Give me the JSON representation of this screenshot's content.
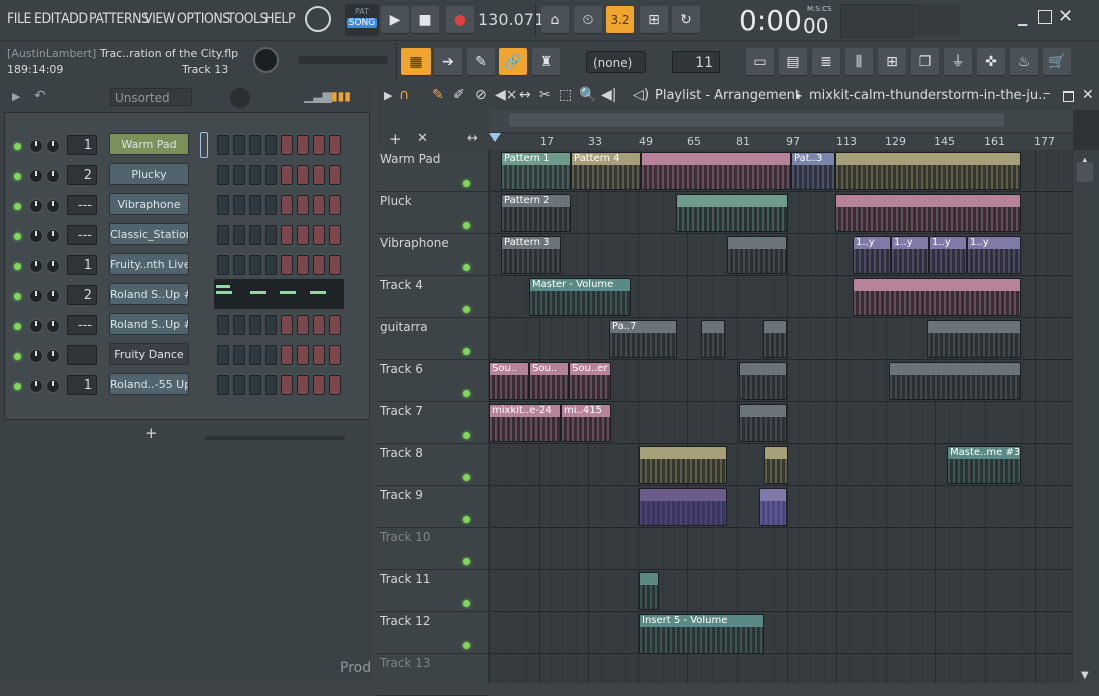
{
  "menu": [
    "FILE",
    "EDIT",
    "ADD",
    "PATTERNS",
    "VIEW",
    "OPTIONS",
    "TOOLS",
    "HELP"
  ],
  "transport": {
    "pat_label": "PAT",
    "song_label": "SONG",
    "tempo": "130.071",
    "time_main": "0:00",
    "time_sub": "00",
    "time_unit": "M:S:CS",
    "pattern_num": "3.2"
  },
  "project": {
    "title": "[AustinLambert]",
    "file": "Trac..ration of the City.flp",
    "position": "189:14:09",
    "track_hint": "Track 13"
  },
  "toolbar2": {
    "pattern_selector": "(none)",
    "step_value": "11"
  },
  "rack": {
    "filter": "Unsorted",
    "add": "+",
    "channels": [
      {
        "num": "1",
        "name": "Warm Pad"
      },
      {
        "num": "2",
        "name": "Plucky"
      },
      {
        "num": "---",
        "name": "Vibraphone"
      },
      {
        "num": "---",
        "name": "Classic_Station"
      },
      {
        "num": "1",
        "name": "Fruity..nth Live"
      },
      {
        "num": "2",
        "name": "Roland S..Up #2"
      },
      {
        "num": "---",
        "name": "Roland S..Up #3"
      },
      {
        "num": "",
        "name": "Fruity Dance"
      },
      {
        "num": "1",
        "name": "Roland..-55 Up"
      }
    ]
  },
  "playlist": {
    "title": "Playlist - Arrangement",
    "breadcrumb": "mixkit-calm-thunderstorm-in-the-ju..",
    "ruler": [
      "17",
      "33",
      "49",
      "65",
      "81",
      "97",
      "113",
      "129",
      "145",
      "161",
      "177"
    ],
    "tracks": [
      "Warm Pad",
      "Pluck",
      "Vibraphone",
      "Track 4",
      "guitarra",
      "Track 6",
      "Track 7",
      "Track 8",
      "Track 9",
      "Track 10",
      "Track 11",
      "Track 12",
      "Track 13"
    ],
    "clips": {
      "p1": "Pattern 1",
      "p4": "Pattern 4",
      "pat3": "Pat..3",
      "p2": "Pattern 2",
      "p3": "Pattern 3",
      "master_vol": "Master - Volume",
      "pa7": "Pa..7",
      "sou1": "Sou..",
      "sou2": "Sou..",
      "sou3": "Sou..er",
      "mix1": "mixkit..e-24",
      "mix2": "mi..415",
      "master3": "Maste..me #3",
      "insert5": "Insert 5 - Volume",
      "y1": "1..y",
      "y2": "1..y",
      "y3": "1..y",
      "y4": "1..y"
    }
  },
  "footer_text": "Prod",
  "colors": {
    "accent": "#f0a52e",
    "led": "#7fd85a",
    "selected_channel": "#7c9159"
  }
}
